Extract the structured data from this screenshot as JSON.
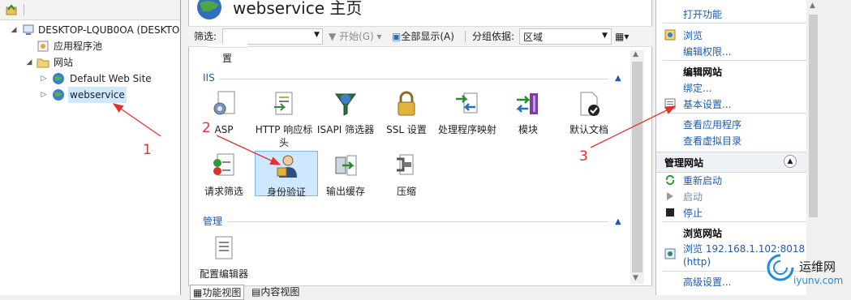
{
  "tree": {
    "root": "DESKTOP-LQUB0OA (DESKTO",
    "app_pools": "应用程序池",
    "sites": "网站",
    "default_site": "Default Web Site",
    "webservice": "webservice"
  },
  "main": {
    "title": "webservice 主页",
    "filter_label": "筛选:",
    "start_label": "开始(G)",
    "show_all_label": "全部显示(A)",
    "group_label": "分组依据:",
    "group_value": "区域",
    "top_partial": [
      "置"
    ],
    "iis_section": "IIS",
    "iis_features": [
      {
        "label": "ASP",
        "icon": "asp-icon"
      },
      {
        "label": "HTTP 响应标头",
        "icon": "http-headers-icon"
      },
      {
        "label": "ISAPI 筛选器",
        "icon": "isapi-filter-icon"
      },
      {
        "label": "SSL 设置",
        "icon": "lock-icon"
      },
      {
        "label": "处理程序映射",
        "icon": "handler-mapping-icon"
      },
      {
        "label": "模块",
        "icon": "modules-icon"
      },
      {
        "label": "默认文档",
        "icon": "default-doc-icon"
      },
      {
        "label": "请求筛选",
        "icon": "request-filter-icon"
      },
      {
        "label": "身份验证",
        "icon": "authentication-icon"
      },
      {
        "label": "输出缓存",
        "icon": "output-cache-icon"
      },
      {
        "label": "压缩",
        "icon": "compression-icon"
      }
    ],
    "manage_section": "管理",
    "manage_features": [
      {
        "label": "配置编辑器",
        "icon": "config-editor-icon"
      }
    ],
    "tabs": [
      "功能视图",
      "内容视图"
    ]
  },
  "actions": {
    "open_feature": "打开功能",
    "browse": "浏览",
    "edit_perms": "编辑权限...",
    "edit_site": "编辑网站",
    "bindings": "绑定...",
    "basic_settings": "基本设置...",
    "view_apps": "查看应用程序",
    "view_vdirs": "查看虚拟目录",
    "manage_site": "管理网站",
    "restart": "重新启动",
    "start": "启动",
    "stop": "停止",
    "browse_site": "浏览网站",
    "browse_url": "浏览 192.168.1.102:8018",
    "browse_proto": "(http)",
    "advanced": "高级设置..."
  },
  "annotations": [
    "1",
    "2",
    "3"
  ],
  "watermark": {
    "cn": "运维网",
    "en": "iyunv.com"
  },
  "colors": {
    "link": "#1e5aa8",
    "selection": "#cde8ff",
    "annotation": "#e2322e"
  }
}
